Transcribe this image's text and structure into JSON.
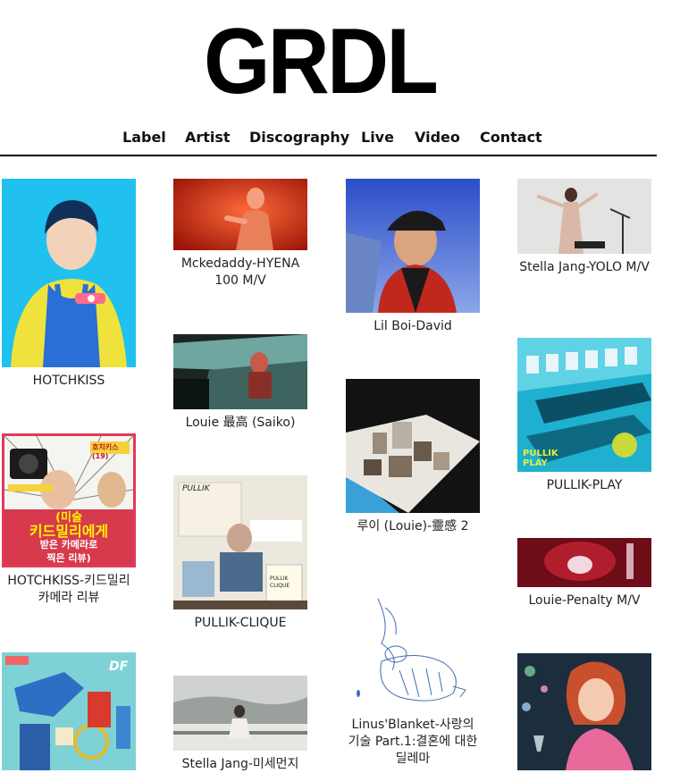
{
  "logo": "GRDL",
  "nav": [
    "Label",
    "Artist",
    "Discography",
    "Live",
    "Video",
    "Contact"
  ],
  "cards": [
    {
      "caption": "HOTCHKISS",
      "icon": "portrait-yellow-shirt-image"
    },
    {
      "caption": "HOTCHKISS-키드밀리 카메라 리뷰",
      "icon": "video-thumbnail-image",
      "overlay": {
        "top": "호치키스 (19)",
        "main1": "(미술",
        "main2": "키드밀리에게",
        "main3": "받은 카메라로",
        "main4": "찍은 리뷰)"
      }
    },
    {
      "caption": "",
      "icon": "album-art-blue-collage-image",
      "badge": "DF"
    },
    {
      "caption": "Mckedaddy-HYENA 100 M/V",
      "icon": "red-stage-image"
    },
    {
      "caption": "Louie 最高 (Saiko)",
      "icon": "car-scene-image"
    },
    {
      "caption": "PULLIK-CLIQUE",
      "icon": "collage-album-image",
      "tag1": "PULLIK",
      "tag2": "PULLIK CLIQUE"
    },
    {
      "caption": "Stella Jang-미세먼지",
      "icon": "rooftop-snow-image"
    },
    {
      "caption": "Lil Boi-David",
      "icon": "portrait-cap-image"
    },
    {
      "caption": "루이 (Louie)-靈感 2",
      "icon": "miniature-buildings-image"
    },
    {
      "caption": "Linus'Blanket-사랑의 기술 Part.1:결혼에 대한 딜레마",
      "icon": "line-drawing-image"
    },
    {
      "caption": "Stella Jang-YOLO M/V",
      "icon": "performer-image"
    },
    {
      "caption": "PULLIK-PLAY",
      "icon": "pool-chairs-image",
      "tag": "PULLIK PLAY"
    },
    {
      "caption": "Louie-Penalty M/V",
      "icon": "red-drink-image"
    },
    {
      "caption": "",
      "icon": "anime-girl-image"
    }
  ]
}
